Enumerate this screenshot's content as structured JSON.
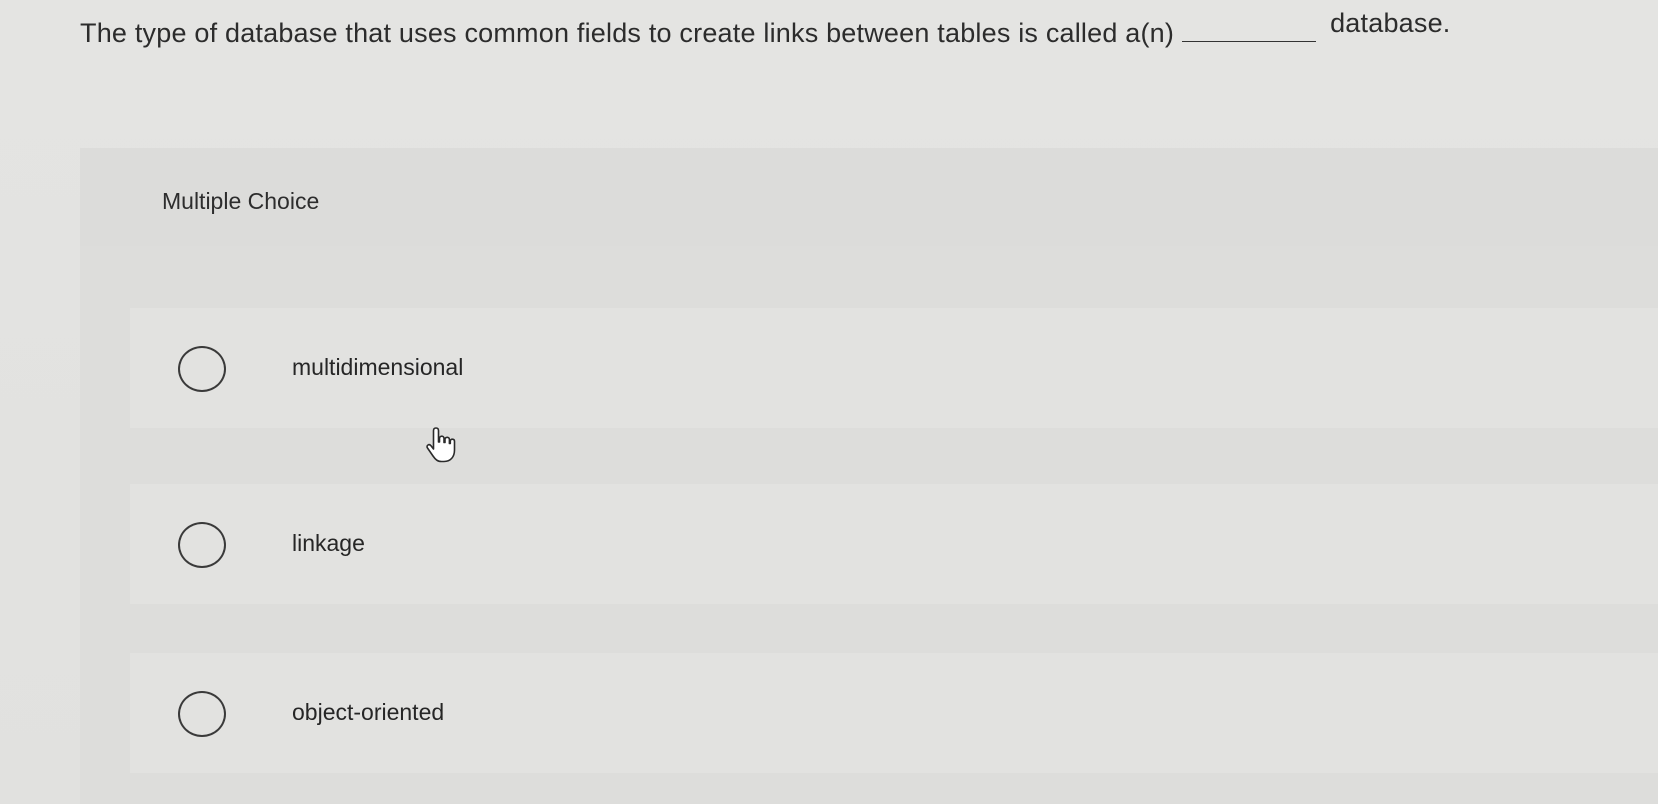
{
  "question": {
    "prefix": "The type of database that uses common fields to create links between tables is called a(n)",
    "suffix": "database."
  },
  "panel": {
    "label": "Multiple Choice"
  },
  "options": [
    {
      "label": "multidimensional",
      "selected": false
    },
    {
      "label": "linkage",
      "selected": false
    },
    {
      "label": "object-oriented",
      "selected": false
    }
  ],
  "cursor": {
    "icon": "hand-pointer-icon"
  }
}
